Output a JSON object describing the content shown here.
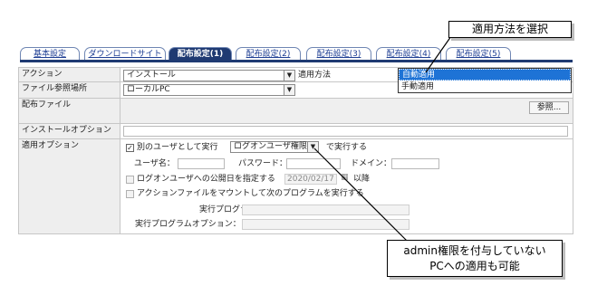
{
  "tabs": [
    {
      "label": "基本設定",
      "active": false
    },
    {
      "label": "ダウンロードサイト",
      "active": false
    },
    {
      "label": "配布設定(1)",
      "active": true
    },
    {
      "label": "配布設定(2)",
      "active": false
    },
    {
      "label": "配布設定(3)",
      "active": false
    },
    {
      "label": "配布設定(4)",
      "active": false
    },
    {
      "label": "配布設定(5)",
      "active": false
    }
  ],
  "form": {
    "action_label": "アクション",
    "action_value": "インストール",
    "apply_method_label": "適用方法",
    "file_ref_label": "ファイル参照場所",
    "file_ref_value": "ローカルPC",
    "dist_file_label": "配布ファイル",
    "browse_button": "参照...",
    "install_option_label": "インストールオプション",
    "apply_option_label": "適用オプション",
    "run_as_other_label": "別のユーザとして実行",
    "run_as_other_checked": true,
    "run_as_select_value": "ログオンユーザ権限",
    "run_suffix": "で実行する",
    "username_label": "ユーザ名：",
    "password_label": "パスワード：",
    "domain_label": "ドメイン：",
    "publish_date_label": "ログオンユーザへの公開日を指定する",
    "publish_date_value": "2020/02/17",
    "publish_after": "以降",
    "mount_label": "アクションファイルをマウントして次のプログラムを実行する",
    "exec_program_label": "実行プログラム：",
    "exec_program_option_label": "実行プログラムオプション："
  },
  "apply_method_popup": {
    "options": [
      "自動適用",
      "手動適用"
    ],
    "selected": "自動適用"
  },
  "callouts": {
    "select_method": "適用方法を選択",
    "admin_line1": "admin権限を付与していない",
    "admin_line2": "PCへの適用も可能"
  },
  "colors": {
    "tab_active_bg": "#1f3a72",
    "tab_text": "#1f3f94",
    "popup_selected": "#1e73d6"
  }
}
